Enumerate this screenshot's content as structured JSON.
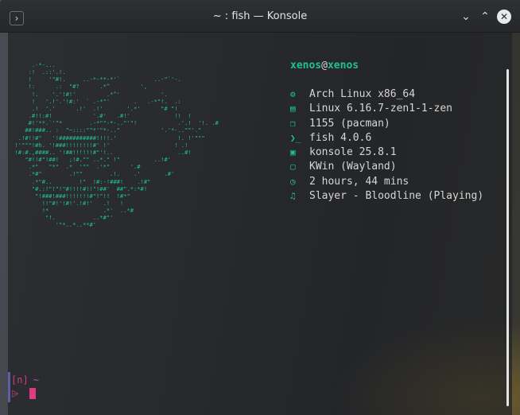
{
  "window": {
    "title": "~ : fish — Konsole",
    "left_button": "›",
    "controls": {
      "minimize": "⌄",
      "maximize": "⌃",
      "close": "✕"
    }
  },
  "fetch": {
    "user": "xenos",
    "at": "@",
    "host": "xenos",
    "ascii_art": "       .-*-...\n      :!  .::'.!.\n      !     '\"#!.     ..-*-**-*'`          ..-\"`'-.\n      !:      .:  \"#?      .*^         ',     \n       !.    '.'!#!'         .*^'            '.\n       !   '.!'.'!#:'  ` .-*\"'       .   .-*\"!.  .:\n       .!  '.'      .!'  .!'       '.*'      \"# \"!\n      .#!!:#!            '.#'   .#!'             !!  !\n      #!'**.`'\"*        .-*\"\"-*-..\"'\"!            .'.!  '!. .#\n     ##!###.. :  \"~::::\"\"*'\"*-..\"            '.'*-..\"\"'.\"\n   .!#!!#\"   '!###########!!!!.'                  !. !'\"\"\"\n  !'\"\"\"!#h. '!###!!!!!!!!#' !'                   ! .!\n  !#:#.,####.. '!##!!!!!!#\"'!..                   ..#!\n     \"#!!#\"!##!   ;!#.\"\" ..*.\" !\"          ..!#'\n      .*\"   \"*\"  .*  '\"\"  .'*\"      '.#\n      .*#\"        .!\"\"        .!.    .'       .#'\n       .*\"#..        !\"  !#:-!###!    .!#\"\n       \"#.:!\"!\"!\"#!!!!#!!\"!##'  ##\".*:*#!\n        \"!###!###!!!!!!!#\"!\"!!  !#*\"\n          !!\"#!'!#!'.!#!'   .!   !\n          !*                .*'  ..*#\n           \"!.           ..*#\"'\n              '\"*..*..**#'",
    "rows": [
      {
        "icon": "gear-icon",
        "glyph": "⚙",
        "text": "Arch Linux x86_64"
      },
      {
        "icon": "server-icon",
        "glyph": "▤",
        "text": "Linux 6.16.7-zen1-1-zen"
      },
      {
        "icon": "package-icon",
        "glyph": "❒",
        "text": "1155 (pacman)"
      },
      {
        "icon": "shell-icon",
        "glyph": "❯_",
        "text": "fish 4.0.6"
      },
      {
        "icon": "terminal-icon",
        "glyph": "▣",
        "text": "konsole 25.8.1"
      },
      {
        "icon": "window-icon",
        "glyph": "▢",
        "text": "KWin (Wayland)"
      },
      {
        "icon": "clock-icon",
        "glyph": "◷",
        "text": "2 hours, 44 mins"
      },
      {
        "icon": "music-note-icon",
        "glyph": "♫",
        "text": "Slayer - Bloodline (Playing)"
      }
    ]
  },
  "prompt": {
    "bracket": "[n]",
    "cwd": "~",
    "arrow": "⩥"
  },
  "colors": {
    "accent": "#1fc195",
    "prompt": "#cc3b7f",
    "text": "#d6d6d6"
  }
}
